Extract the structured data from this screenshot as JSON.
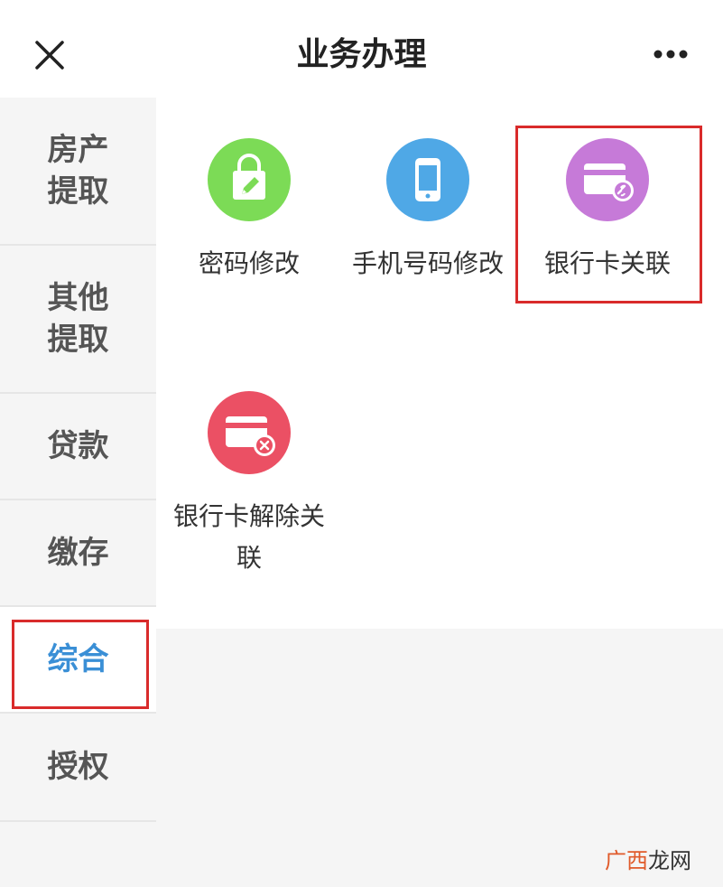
{
  "header": {
    "title": "业务办理",
    "close_icon": "close-icon",
    "more_icon": "more-dots-icon"
  },
  "sidebar": {
    "items": [
      {
        "label": "房产提取",
        "active": false
      },
      {
        "label": "其他提取",
        "active": false
      },
      {
        "label": "贷款",
        "active": false
      },
      {
        "label": "缴存",
        "active": false
      },
      {
        "label": "综合",
        "active": true
      },
      {
        "label": "授权",
        "active": false
      }
    ],
    "active_color": "#3a8fd6"
  },
  "services": [
    {
      "label": "密码修改",
      "icon": "bag-pen-icon",
      "color": "#7cdb56"
    },
    {
      "label": "手机号码修改",
      "icon": "phone-icon",
      "color": "#4fa8e6"
    },
    {
      "label": "银行卡关联",
      "icon": "card-link-icon",
      "color": "#c67ad8"
    },
    {
      "label": "银行卡解除关联",
      "icon": "card-unlink-icon",
      "color": "#eb5064"
    }
  ],
  "annotation_color": "#d92b2b",
  "watermark": {
    "part1": "广西",
    "part2": "龙网"
  }
}
